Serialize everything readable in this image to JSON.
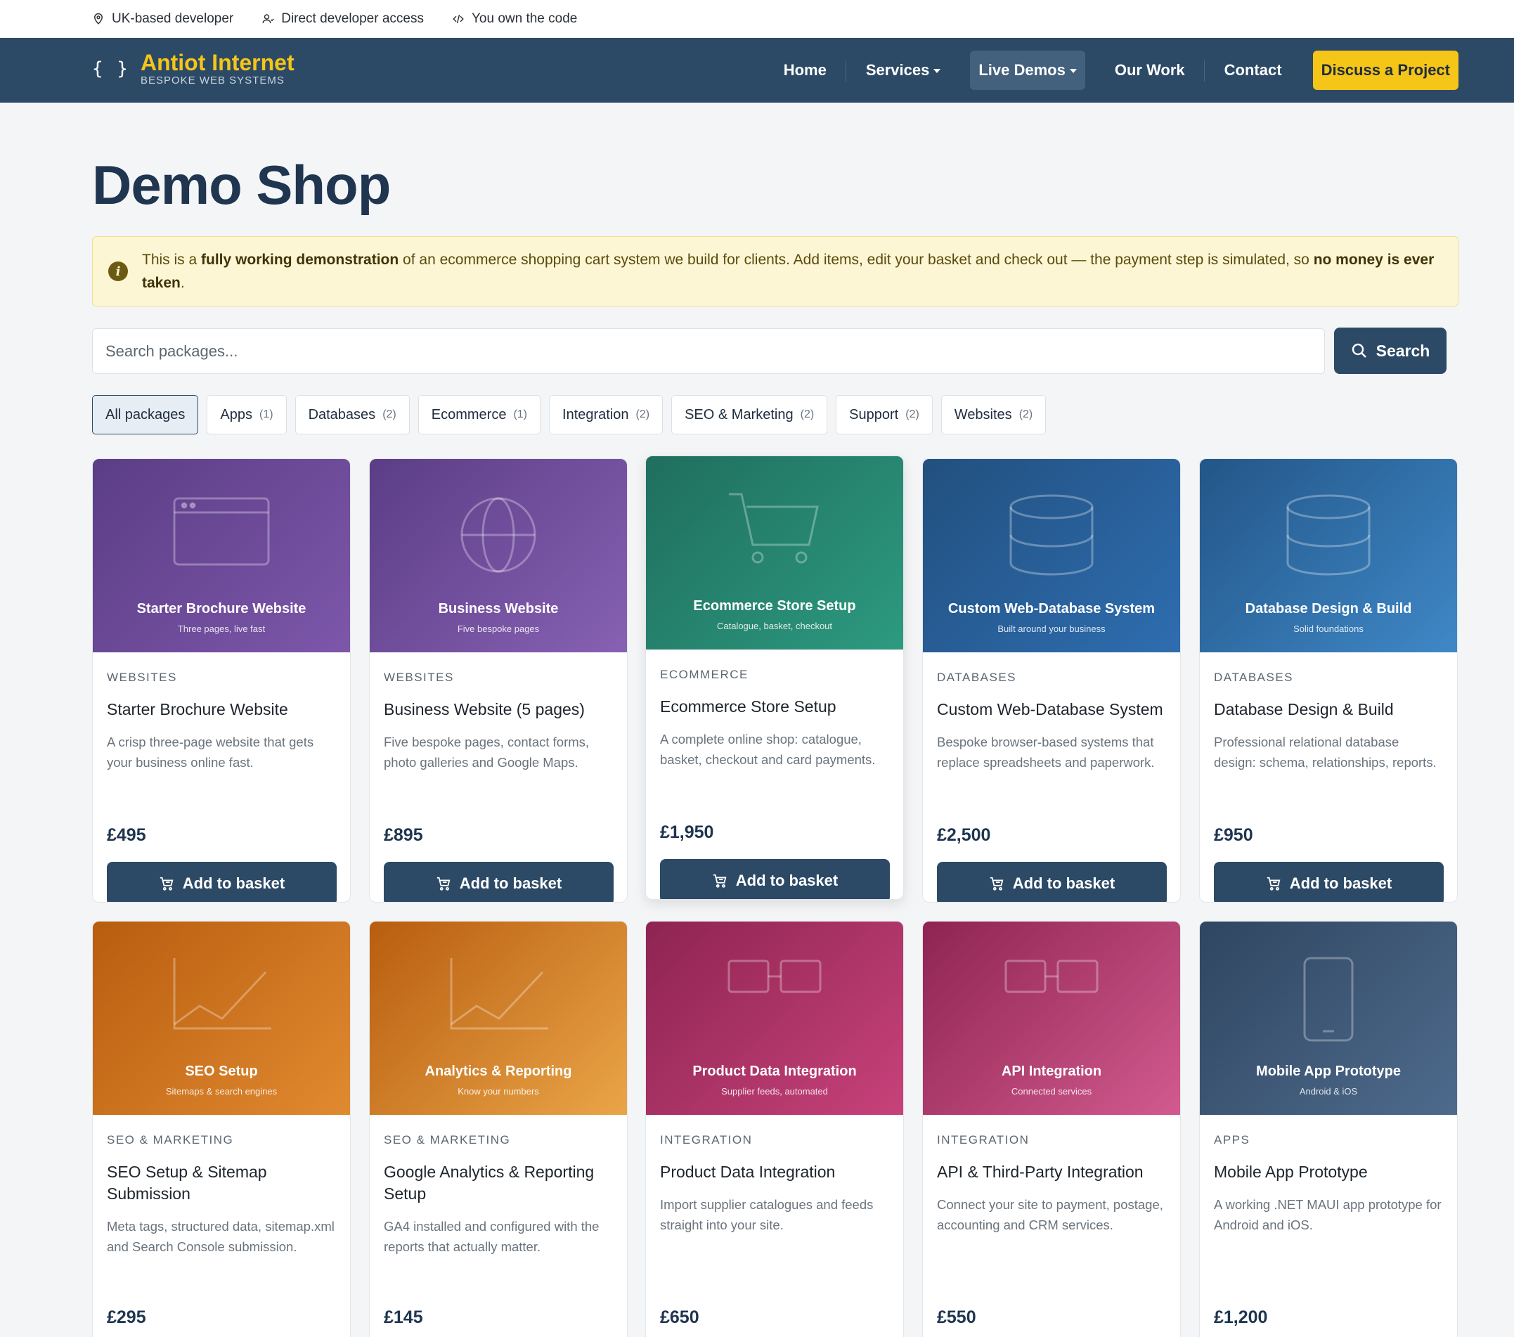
{
  "topbar": [
    {
      "icon": "location-pin-icon",
      "text": "UK-based developer"
    },
    {
      "icon": "user-icon",
      "text": "Direct developer access"
    },
    {
      "icon": "code-icon",
      "text": "You own the code"
    }
  ],
  "brand": {
    "braces": "{ }",
    "title": "Antiot Internet",
    "subtitle": "BESPOKE WEB SYSTEMS"
  },
  "nav": {
    "home": "Home",
    "services": "Services",
    "live_demos": "Live Demos",
    "our_work": "Our Work",
    "contact": "Contact",
    "cta": "Discuss a Project"
  },
  "page": {
    "title": "Demo Shop"
  },
  "notice": {
    "part1": "This is a ",
    "bold1": "fully working demonstration",
    "part2": " of an ecommerce shopping cart system we build for clients. Add items, edit your basket and check out — the payment step is simulated, so ",
    "bold2": "no money is ever taken",
    "part3": "."
  },
  "search": {
    "placeholder": "Search packages...",
    "button": "Search"
  },
  "filters": [
    {
      "label": "All packages",
      "count": "",
      "active": true
    },
    {
      "label": "Apps",
      "count": "(1)"
    },
    {
      "label": "Databases",
      "count": "(2)"
    },
    {
      "label": "Ecommerce",
      "count": "(1)"
    },
    {
      "label": "Integration",
      "count": "(2)"
    },
    {
      "label": "SEO & Marketing",
      "count": "(2)"
    },
    {
      "label": "Support",
      "count": "(2)"
    },
    {
      "label": "Websites",
      "count": "(2)"
    }
  ],
  "add_label": "Add to basket",
  "products": [
    {
      "banner_title": "Starter Brochure Website",
      "banner_sub": "Three pages, live fast",
      "category": "Websites",
      "name": "Starter Brochure Website",
      "desc": "A crisp three-page website that gets your business online fast.",
      "price": "£495",
      "icon": "browser-window-icon",
      "colors": [
        "#5b3d86",
        "#7d57aa"
      ]
    },
    {
      "banner_title": "Business Website",
      "banner_sub": "Five bespoke pages",
      "category": "Websites",
      "name": "Business Website (5 pages)",
      "desc": "Five bespoke pages, contact forms, photo galleries and Google Maps.",
      "price": "£895",
      "icon": "globe-icon",
      "colors": [
        "#5b3d86",
        "#8761b3"
      ]
    },
    {
      "banner_title": "Ecommerce Store Setup",
      "banner_sub": "Catalogue, basket, checkout",
      "category": "Ecommerce",
      "name": "Ecommerce Store Setup",
      "desc": "A complete online shop: catalogue, basket, checkout and card payments.",
      "price": "£1,950",
      "icon": "shopping-cart-icon",
      "colors": [
        "#1f6e5e",
        "#2d9a80"
      ]
    },
    {
      "banner_title": "Custom Web-Database System",
      "banner_sub": "Built around your business",
      "category": "Databases",
      "name": "Custom Web-Database System",
      "desc": "Bespoke browser-based systems that replace spreadsheets and paperwork.",
      "price": "£2,500",
      "icon": "database-icon",
      "colors": [
        "#22507f",
        "#2e6db0"
      ]
    },
    {
      "banner_title": "Database Design & Build",
      "banner_sub": "Solid foundations",
      "category": "Databases",
      "name": "Database Design & Build",
      "desc": "Professional relational database design: schema, relationships, reports.",
      "price": "£950",
      "icon": "database-icon",
      "colors": [
        "#235688",
        "#3f88c7"
      ]
    },
    {
      "banner_title": "SEO Setup",
      "banner_sub": "Sitemaps & search engines",
      "category": "SEO & Marketing",
      "name": "SEO Setup & Sitemap Submission",
      "desc": "Meta tags, structured data, sitemap.xml and Search Console submission.",
      "price": "£295",
      "icon": "line-chart-icon",
      "colors": [
        "#b85d0f",
        "#e08a30"
      ]
    },
    {
      "banner_title": "Analytics & Reporting",
      "banner_sub": "Know your numbers",
      "category": "SEO & Marketing",
      "name": "Google Analytics & Reporting Setup",
      "desc": "GA4 installed and configured with the reports that actually matter.",
      "price": "£145",
      "icon": "line-chart-icon",
      "colors": [
        "#b85d0f",
        "#eaa548"
      ]
    },
    {
      "banner_title": "Product Data Integration",
      "banner_sub": "Supplier feeds, automated",
      "category": "Integration",
      "name": "Product Data Integration",
      "desc": "Import supplier catalogues and feeds straight into your site.",
      "price": "£650",
      "icon": "link-icon",
      "colors": [
        "#8e2452",
        "#c7427a"
      ]
    },
    {
      "banner_title": "API Integration",
      "banner_sub": "Connected services",
      "category": "Integration",
      "name": "API & Third-Party Integration",
      "desc": "Connect your site to payment, postage, accounting and CRM services.",
      "price": "£550",
      "icon": "link-icon",
      "colors": [
        "#8e2452",
        "#d25a8e"
      ]
    },
    {
      "banner_title": "Mobile App Prototype",
      "banner_sub": "Android & iOS",
      "category": "Apps",
      "name": "Mobile App Prototype",
      "desc": "A working .NET MAUI app prototype for Android and iOS.",
      "price": "£1,200",
      "icon": "mobile-phone-icon",
      "colors": [
        "#2f4661",
        "#4e6a8c"
      ]
    }
  ]
}
